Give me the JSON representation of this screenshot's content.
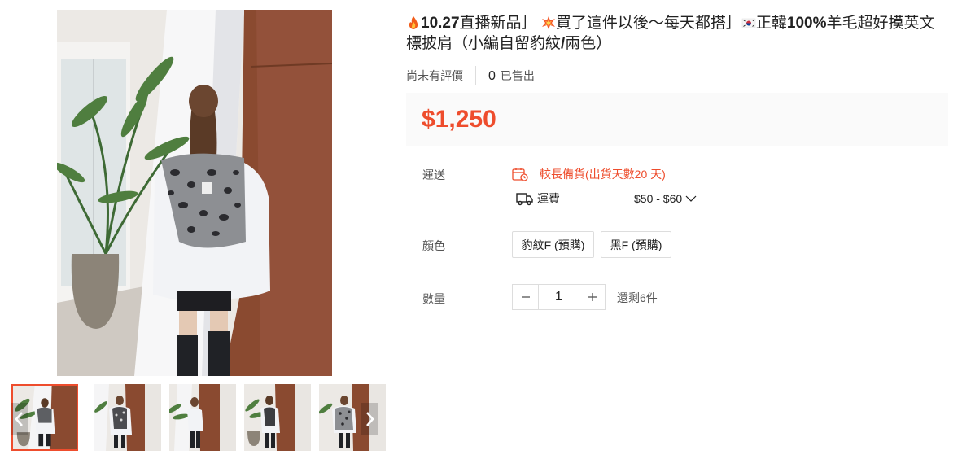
{
  "product": {
    "title_parts": {
      "p1_bold": "10.27",
      "p2": "直播新品］",
      "p3": "買了這件以後～每天都搭］",
      "p4": "正韓",
      "p5_bold": "100%",
      "p6": "羊毛超好摸英文標披肩（小編自留豹紋",
      "p7_bold": "/",
      "p8": "兩色）"
    },
    "rating_text": "尚未有評價",
    "sold_count": "0",
    "sold_label": "已售出",
    "price": "$1,250"
  },
  "gallery": {
    "thumbnail_count": 5,
    "selected_index": 0
  },
  "shipping": {
    "label": "運送",
    "lead_time_text": "較長備貨(出貨天數20 天)",
    "fee_label": "運費",
    "fee_range": "$50 - $60"
  },
  "variation": {
    "label": "顏色",
    "options": [
      "豹紋F (預購)",
      "黑F (預購)"
    ]
  },
  "quantity": {
    "label": "數量",
    "value": "1",
    "stock_text": "還剩6件"
  },
  "icons": {
    "flame": "fire-emoji-icon",
    "collision": "collision-emoji-icon",
    "flag": "korea-flag-icon",
    "calendar": "calendar-clock-icon",
    "truck": "truck-icon",
    "chevron": "chevron-down-icon",
    "minus": "minus-icon",
    "plus": "plus-icon",
    "prev": "chevron-left-icon",
    "next": "chevron-right-icon"
  },
  "colors": {
    "accent": "#ee4d2d",
    "price_bg": "#fafafa",
    "border": "#dddddd",
    "muted_text": "#555555"
  }
}
